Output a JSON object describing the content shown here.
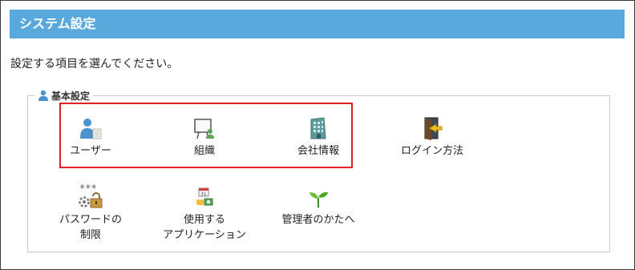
{
  "page": {
    "title": "システム設定",
    "intro": "設定する項目を選んでください。"
  },
  "section": {
    "legend": "基本設定",
    "legend_icon": "user-icon"
  },
  "items": [
    {
      "label": "ユーザー",
      "icon": "user-list-icon"
    },
    {
      "label": "組織",
      "icon": "organization-icon"
    },
    {
      "label": "会社情報",
      "icon": "building-icon"
    },
    {
      "label": "ログイン方法",
      "icon": "door-login-icon"
    },
    {
      "label_line1": "パスワードの",
      "label_line2": "制限",
      "icon": "password-lock-icon"
    },
    {
      "label_line1": "使用する",
      "label_line2": "アプリケーション",
      "icon": "applications-icon"
    },
    {
      "label": "管理者のかたへ",
      "icon": "sprout-icon"
    }
  ],
  "colors": {
    "titlebar": "#5aa9dc",
    "highlight": "#e02020"
  }
}
